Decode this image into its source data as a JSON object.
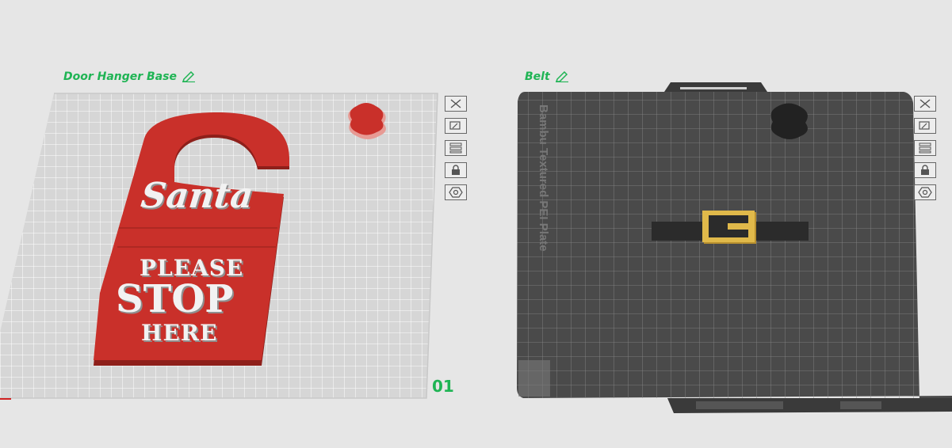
{
  "plates": [
    {
      "name": "Door Hanger Base",
      "number": "01"
    },
    {
      "name": "Belt",
      "bed_label": "Bambu Textured PEI Plate"
    }
  ],
  "model": {
    "line1": "Santa",
    "line2": "PLEASE",
    "line3": "STOP",
    "line4": "HERE"
  },
  "colors": {
    "accent": "#1fb454",
    "model_red": "#c9302a",
    "bed_dark": "#4a4a4a",
    "bed_light": "#d6d6d6",
    "buckle": "#e0b94a"
  }
}
